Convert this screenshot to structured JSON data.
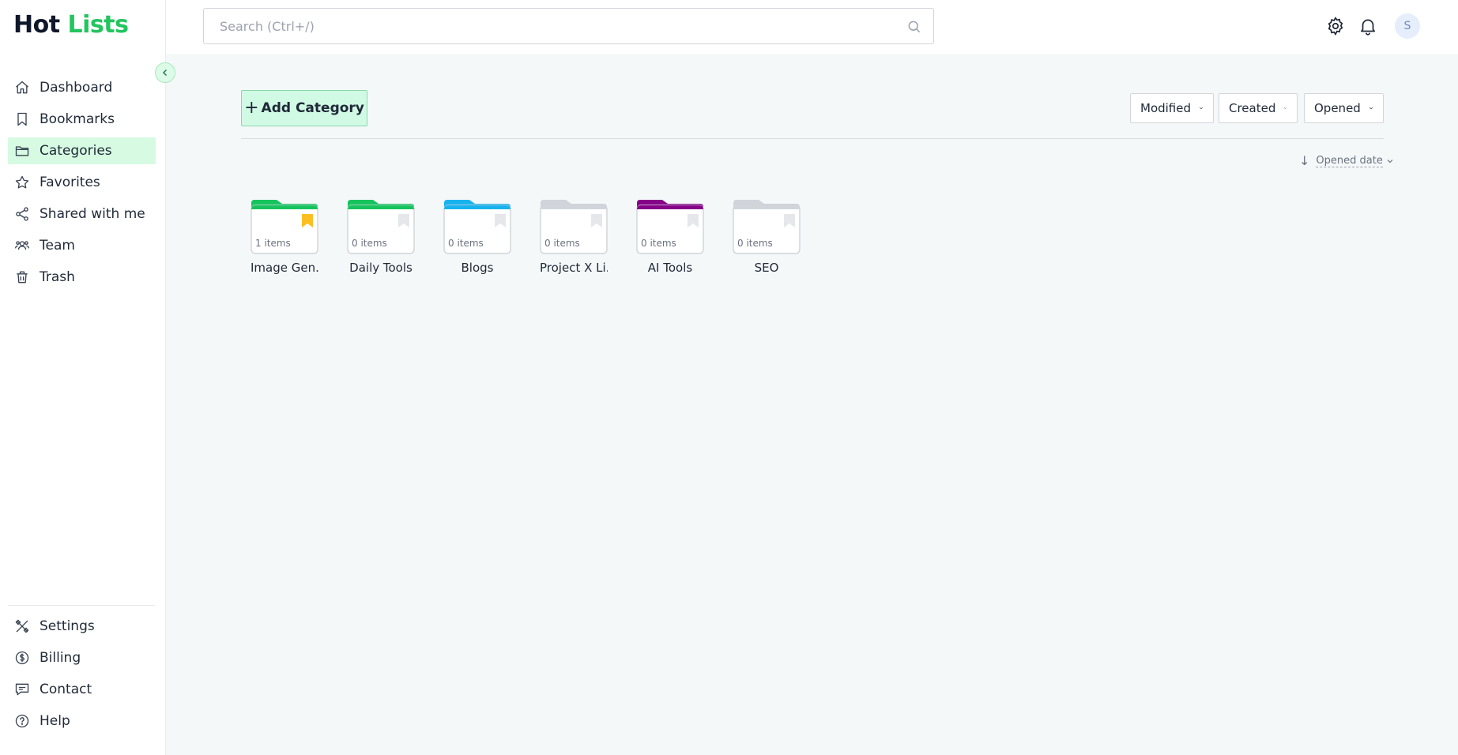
{
  "app": {
    "logo_part1": "Hot",
    "logo_part2": "Lists"
  },
  "sidebar": {
    "items": [
      {
        "label": "Dashboard",
        "icon": "home-icon",
        "active": false
      },
      {
        "label": "Bookmarks",
        "icon": "bookmark-icon",
        "active": false
      },
      {
        "label": "Categories",
        "icon": "folder-icon",
        "active": true
      },
      {
        "label": "Favorites",
        "icon": "star-icon",
        "active": false
      },
      {
        "label": "Shared with me",
        "icon": "share-icon",
        "active": false
      },
      {
        "label": "Team",
        "icon": "users-icon",
        "active": false
      },
      {
        "label": "Trash",
        "icon": "trash-icon",
        "active": false
      }
    ],
    "bottom_items": [
      {
        "label": "Settings",
        "icon": "tools-icon"
      },
      {
        "label": "Billing",
        "icon": "dollar-icon"
      },
      {
        "label": "Contact",
        "icon": "message-icon"
      },
      {
        "label": "Help",
        "icon": "help-icon"
      }
    ]
  },
  "search": {
    "placeholder": "Search (Ctrl+/)"
  },
  "header": {
    "avatar_initial": "S"
  },
  "toolbar": {
    "add_label": "Add Category",
    "filters": [
      "Modified",
      "Created",
      "Opened"
    ],
    "sort_label": "Opened date"
  },
  "folders": [
    {
      "name": "Image Gen...",
      "count": "1 items",
      "color": "#16c45e",
      "bookmark_color": "#fbbf24"
    },
    {
      "name": "Daily Tools",
      "count": "0 items",
      "color": "#16c45e",
      "bookmark_color": "#e5e7eb"
    },
    {
      "name": "Blogs",
      "count": "0 items",
      "color": "#18b3ee",
      "bookmark_color": "#e5e7eb"
    },
    {
      "name": "Project X Li...",
      "count": "0 items",
      "color": "#d1d5db",
      "bookmark_color": "#e5e7eb"
    },
    {
      "name": "AI Tools",
      "count": "0 items",
      "color": "#860389",
      "bookmark_color": "#e5e7eb"
    },
    {
      "name": "SEO",
      "count": "0 items",
      "color": "#d1d5db",
      "bookmark_color": "#e5e7eb"
    }
  ],
  "colors": {
    "accent": "#22c55e",
    "active_bg": "#d6fbe2",
    "add_bg": "#d1fae5"
  }
}
